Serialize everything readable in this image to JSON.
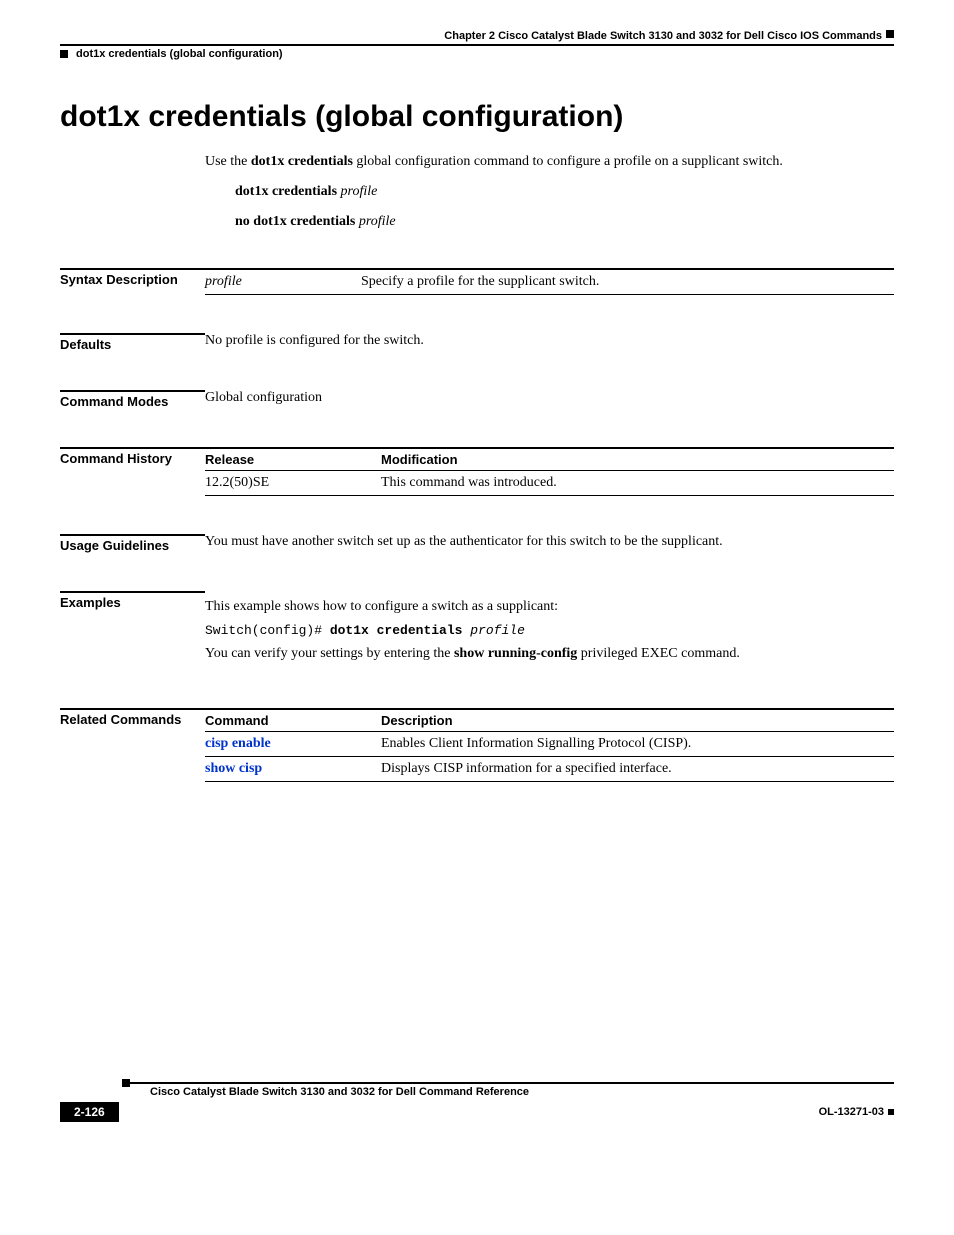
{
  "header": {
    "chapter": "Chapter 2      Cisco Catalyst Blade Switch 3130 and 3032 for Dell Cisco IOS Commands",
    "breadcrumb": "dot1x credentials (global configuration)"
  },
  "title": "dot1x credentials (global configuration)",
  "intro": {
    "prefix": "Use the ",
    "cmd": "dot1x credentials",
    "suffix": " global configuration command to configure a profile on a supplicant switch."
  },
  "syntax": {
    "line1_cmd": "dot1x credentials ",
    "line1_arg": "profile",
    "line2_cmd": "no dot1x credentials ",
    "line2_arg": "profile"
  },
  "sections": {
    "syntax_description": {
      "label": "Syntax Description",
      "param": "profile",
      "desc": "Specify a profile for the supplicant switch."
    },
    "defaults": {
      "label": "Defaults",
      "text": "No profile is configured for the switch."
    },
    "command_modes": {
      "label": "Command Modes",
      "text": "Global configuration"
    },
    "command_history": {
      "label": "Command History",
      "col1": "Release",
      "col2": "Modification",
      "rows": [
        {
          "release": "12.2(50)SE",
          "modification": "This command was introduced."
        }
      ]
    },
    "usage_guidelines": {
      "label": "Usage Guidelines",
      "text": "You must have another switch set up as the authenticator for this switch to be the supplicant."
    },
    "examples": {
      "label": "Examples",
      "intro": "This example shows how to configure a switch as a supplicant:",
      "code_prefix": "Switch(config)# ",
      "code_cmd": "dot1x credentials ",
      "code_arg": "profile",
      "verify_prefix": "You can verify your settings by entering the ",
      "verify_cmd": "show running-config",
      "verify_suffix": " privileged EXEC command."
    },
    "related_commands": {
      "label": "Related Commands",
      "col1": "Command",
      "col2": "Description",
      "rows": [
        {
          "cmd": "cisp enable",
          "desc": "Enables Client Information Signalling Protocol (CISP)."
        },
        {
          "cmd": "show cisp",
          "desc": "Displays CISP information for a specified interface."
        }
      ]
    }
  },
  "footer": {
    "book_title": "Cisco Catalyst Blade Switch 3130 and 3032 for Dell Command Reference",
    "page_number": "2-126",
    "doc_id": "OL-13271-03"
  }
}
